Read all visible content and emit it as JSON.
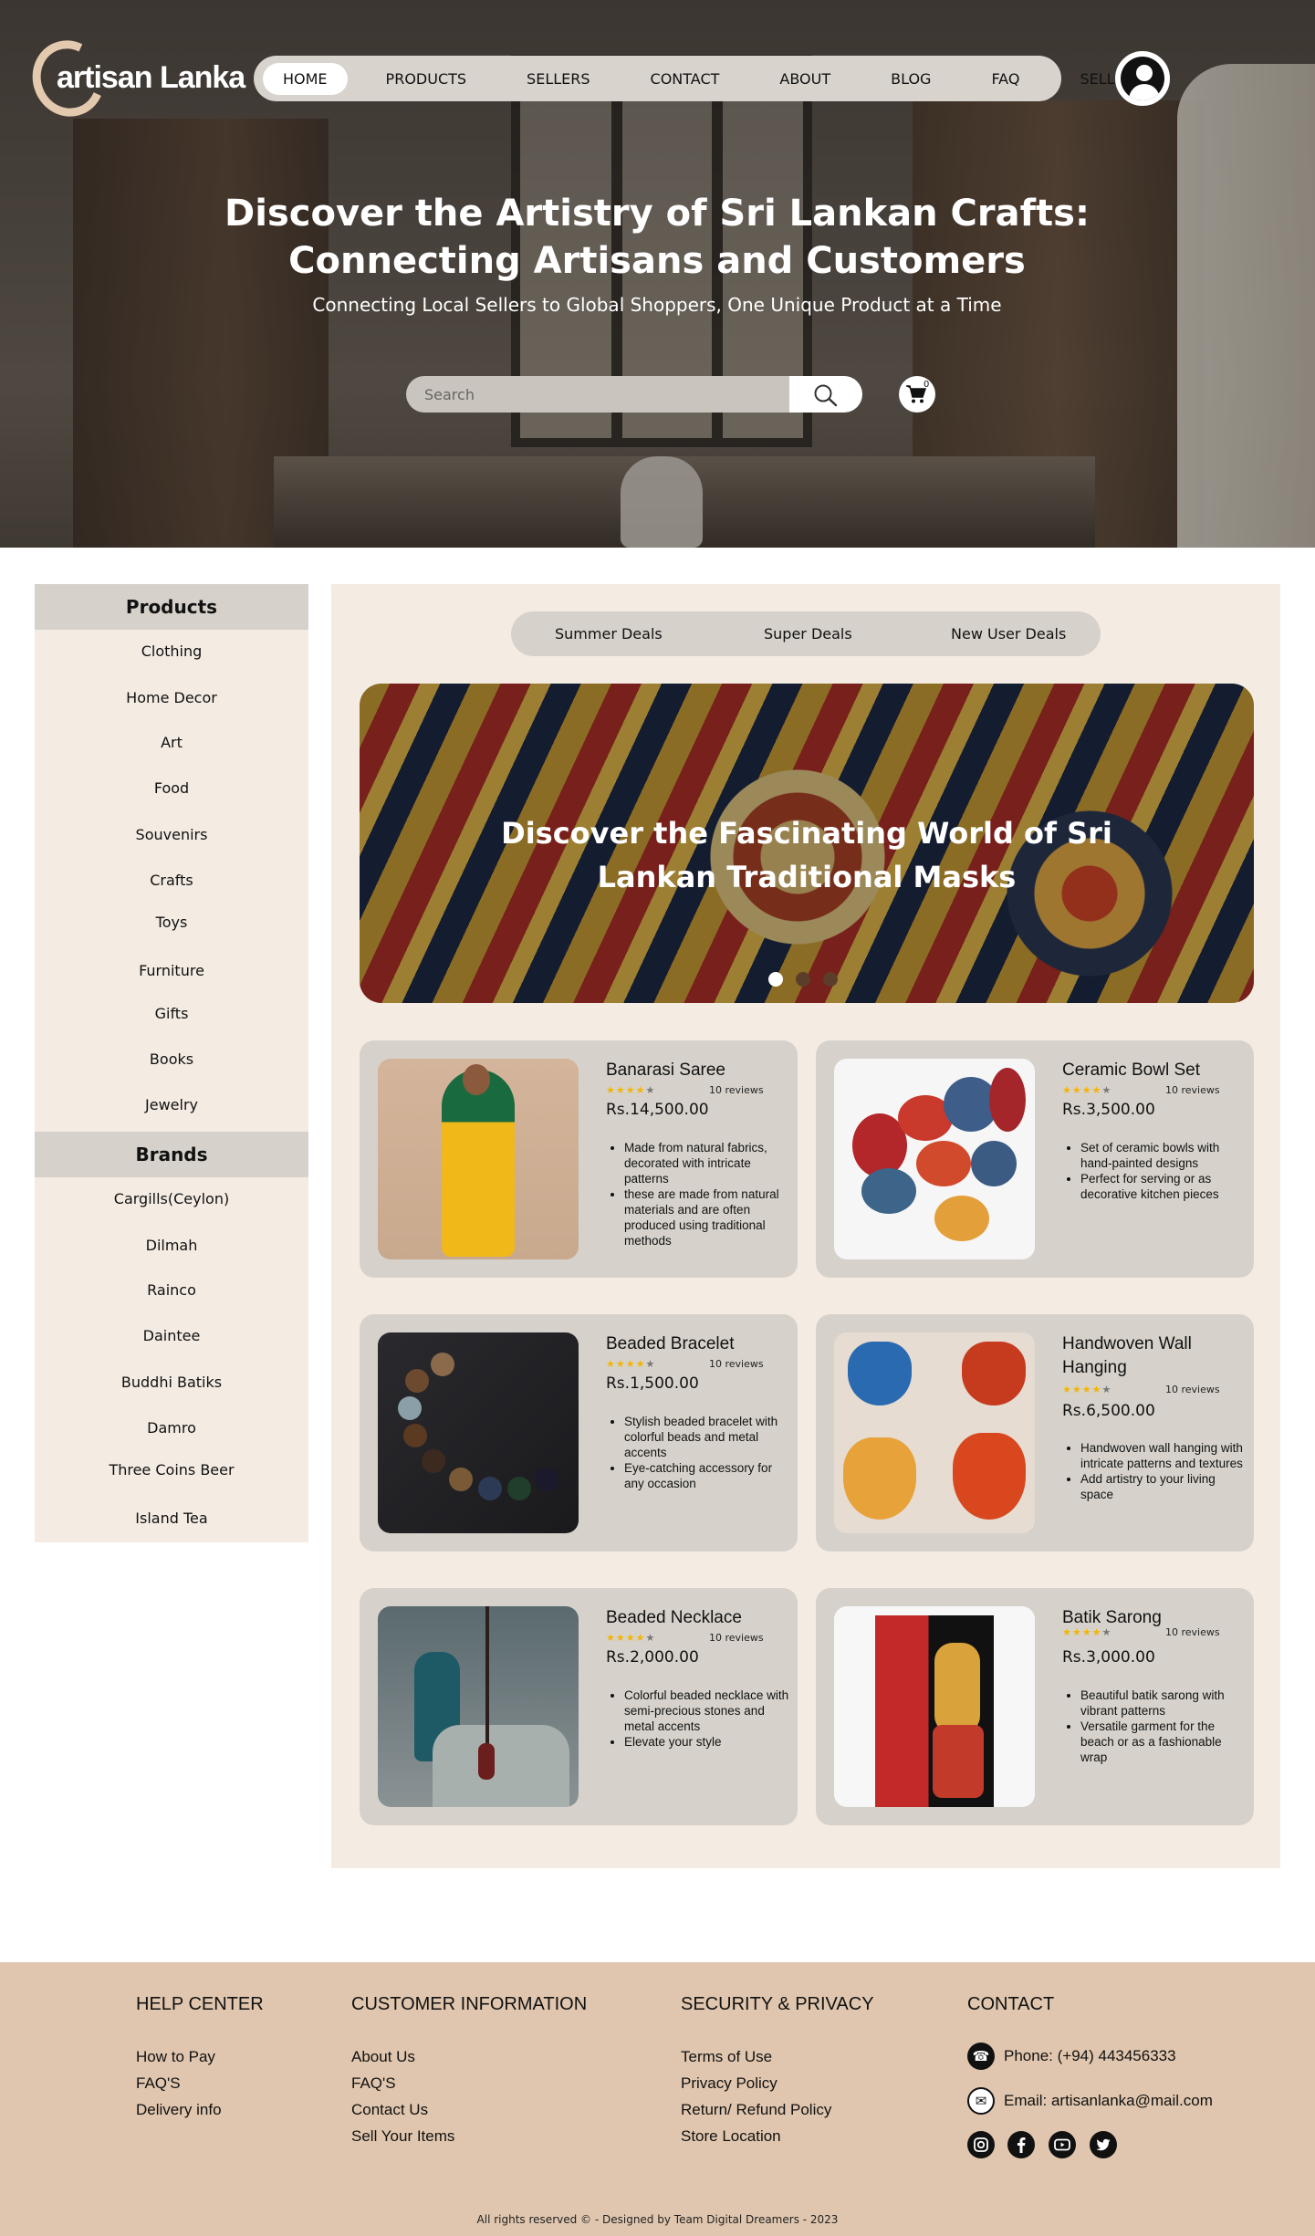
{
  "brand": {
    "logo_text": "artisan Lanka"
  },
  "nav": {
    "items": [
      "HOME",
      "PRODUCTS",
      "SELLERS",
      "CONTACT",
      "ABOUT",
      "BLOG",
      "FAQ",
      "SELL"
    ],
    "active": "HOME"
  },
  "hero": {
    "title": "Discover the Artistry of Sri Lankan Crafts: Connecting Artisans and Customers",
    "subtitle": "Connecting Local Sellers to Global Shoppers, One Unique Product at a Time",
    "search_placeholder": "Search",
    "cart_count": "0"
  },
  "sidebar": {
    "products_title": "Products",
    "products": [
      "Clothing",
      "Home Decor",
      "Art",
      "Food",
      "Souvenirs",
      "Crafts",
      "Toys",
      "Furniture",
      "Gifts",
      "Books",
      "Jewelry"
    ],
    "brands_title": "Brands",
    "brands": [
      "Cargills(Ceylon)",
      "Dilmah",
      "Rainco",
      "Daintee",
      "Buddhi Batiks",
      "Damro",
      "Three Coins Beer",
      "Island Tea"
    ]
  },
  "deals": [
    "Summer Deals",
    "Super Deals",
    "New User Deals"
  ],
  "banner": {
    "title": "Discover the Fascinating World of Sri Lankan Traditional Masks",
    "slide_count": 3,
    "active_slide": 1
  },
  "products": [
    {
      "name": "Banarasi Saree",
      "rating": 4,
      "reviews": "10 reviews",
      "price": "Rs.14,500.00",
      "features": [
        "Made from natural fabrics, decorated with intricate patterns",
        "these are made from natural materials and are often produced using traditional methods"
      ]
    },
    {
      "name": "Ceramic Bowl Set",
      "rating": 4,
      "reviews": "10 reviews",
      "price": "Rs.3,500.00",
      "features": [
        "Set of ceramic bowls with hand-painted designs",
        "Perfect for serving or as decorative kitchen pieces"
      ]
    },
    {
      "name": "Beaded Bracelet",
      "rating": 4,
      "reviews": "10 reviews",
      "price": "Rs.1,500.00",
      "features": [
        "Stylish beaded bracelet with colorful beads and metal accents",
        "Eye-catching accessory for any occasion"
      ]
    },
    {
      "name": "Handwoven Wall Hanging",
      "rating": 4,
      "reviews": "10 reviews",
      "price": "Rs.6,500.00",
      "features": [
        "Handwoven wall hanging with intricate patterns and textures",
        "Add artistry to your living space"
      ]
    },
    {
      "name": "Beaded Necklace",
      "rating": 4,
      "reviews": "10 reviews",
      "price": "Rs.2,000.00",
      "features": [
        "Colorful beaded necklace with semi-precious stones and metal accents",
        "Elevate your style"
      ]
    },
    {
      "name": "Batik Sarong",
      "rating": 4,
      "reviews": "10 reviews",
      "price": "Rs.3,000.00",
      "features": [
        "Beautiful batik sarong with vibrant patterns",
        "Versatile garment for the beach or as a fashionable wrap"
      ]
    }
  ],
  "footer": {
    "help_center": {
      "title": "HELP CENTER",
      "links": [
        "How to Pay",
        "FAQ'S",
        "Delivery info"
      ]
    },
    "customer_info": {
      "title": "CUSTOMER INFORMATION",
      "links": [
        "About Us",
        "FAQ'S",
        "Contact Us",
        "Sell Your Items"
      ]
    },
    "security": {
      "title": "SECURITY & PRIVACY",
      "links": [
        "Terms of Use",
        "Privacy Policy",
        "Return/ Refund Policy",
        "Store Location"
      ]
    },
    "contact": {
      "title": "CONTACT",
      "phone": "Phone: (+94) 443456333",
      "email": "Email: artisanlanka@mail.com"
    },
    "social": [
      "instagram-icon",
      "facebook-icon",
      "youtube-icon",
      "twitter-icon"
    ],
    "copyright": "All rights reserved © - Designed by Team Digital Dreamers - 2023"
  }
}
